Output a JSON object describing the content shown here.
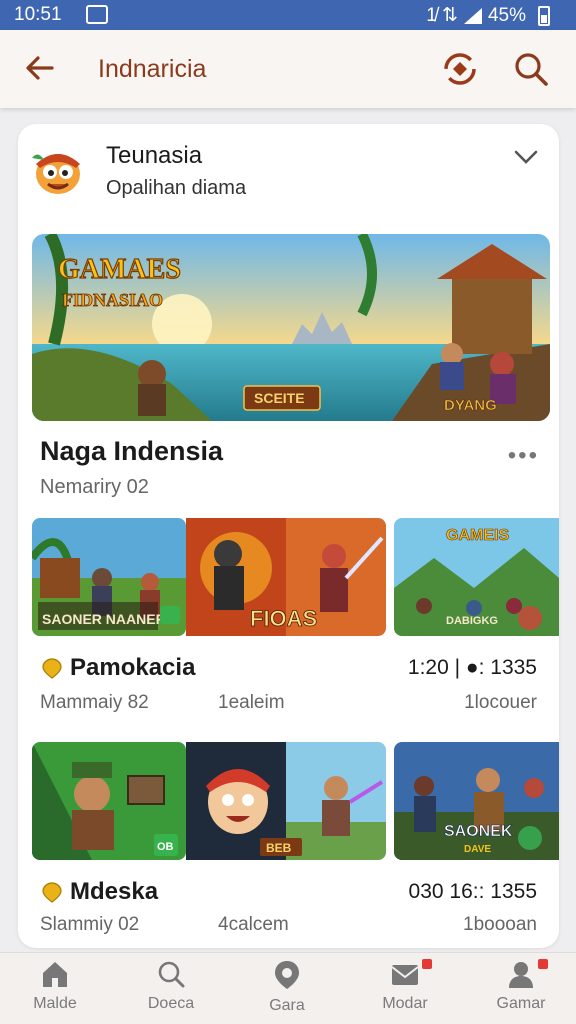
{
  "status": {
    "time": "10:51",
    "indicators": "1̸ ⇅",
    "battery": "45%"
  },
  "appbar": {
    "title": "Indnaricia",
    "back_icon": "arrow-left-icon",
    "sync_icon": "sync-icon",
    "search_icon": "search-icon"
  },
  "header": {
    "title": "Teunasia",
    "subtitle": "Opalihan diama"
  },
  "hero": {
    "banner_title": "GAMAES",
    "banner_subtitle": "FIDNASIAO",
    "banner_center_label": "SCEITE",
    "banner_right_label": "DYANG",
    "title": "Naga Indensia",
    "subtitle": "Nemariry 02",
    "more": "•••"
  },
  "rows": [
    {
      "thumb_labels": [
        "SAONER NAANER",
        "FIOAS",
        "GAMEIS",
        "DABIGKG"
      ],
      "name": "Pamokacia",
      "count": "1:20 | ●: 1335",
      "meta_left": "Mammaiy 82",
      "meta_mid": "1ealeim",
      "meta_right": "1locouer"
    },
    {
      "thumb_labels": [
        "OB",
        "BEB",
        "SAONEK",
        "DAVE"
      ],
      "name": "Mdeska",
      "count": "030 16:: 1355",
      "meta_left": "Slammiy 02",
      "meta_mid": "4calcem",
      "meta_right": "1boooan"
    }
  ],
  "nav": [
    {
      "label": "Malde",
      "icon": "home-icon"
    },
    {
      "label": "Doeca",
      "icon": "search-icon"
    },
    {
      "label": "Gara",
      "icon": "location-icon"
    },
    {
      "label": "Modar",
      "icon": "mail-icon"
    },
    {
      "label": "Gamar",
      "icon": "user-icon"
    }
  ],
  "colors": {
    "status_bar": "#3f66b0",
    "accent": "#8a3b1c",
    "card": "#ffffff",
    "badge": "#d69b00",
    "notification": "#e53935"
  }
}
